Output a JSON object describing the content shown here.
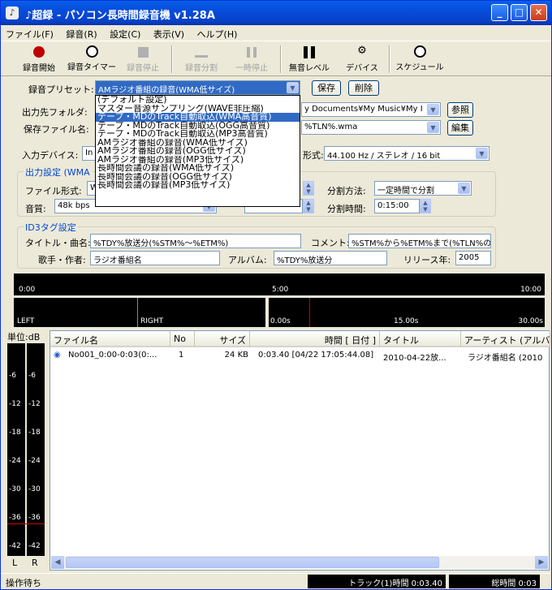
{
  "title": "♪超録 - パソコン長時間録音機 v1.28A",
  "menu": [
    "ファイル(F)",
    "録音(R)",
    "設定(C)",
    "表示(V)",
    "ヘルプ(H)"
  ],
  "toolbar": {
    "record_start": "録音開始",
    "record_timer": "録音タイマー",
    "record_stop": "録音停止",
    "record_split": "録音分割",
    "pause": "一時停止",
    "silence_level": "無音レベル",
    "device": "デバイス",
    "schedule": "スケジュール"
  },
  "preset": {
    "label": "録音プリセット:",
    "value": "AMラジオ番組の録音(WMA低サイズ)",
    "save": "保存",
    "delete": "削除"
  },
  "preset_options": [
    "(デフォルト設定)",
    "マスター音源サンプリング(WAVE非圧縮)",
    "テープ・MDのTrack自動取込(WMA高音質)",
    "テープ・MDのTrack自動取込(OGG高音質)",
    "テープ・MDのTrack自動取込(MP3高音質)",
    "AMラジオ番組の録音(WMA低サイズ)",
    "AMラジオ番組の録音(OGG低サイズ)",
    "AMラジオ番組の録音(MP3低サイズ)",
    "長時間会議の録音(WMA低サイズ)",
    "長時間会議の録音(OGG低サイズ)",
    "長時間会議の録音(MP3低サイズ)"
  ],
  "output": {
    "folder_label": "出力先フォルダ:",
    "folder_value": "y Documents¥My Music¥My I",
    "browse": "参照",
    "file_label": "保存ファイル名:",
    "file_value": "%TLN%.wma",
    "edit": "編集"
  },
  "input": {
    "device_label": "入力デバイス:",
    "device_value": "In",
    "format_label": "形式:",
    "format_value": "44.100 Hz / ステレオ / 16 bit"
  },
  "out_settings": {
    "group_title": "出力設定 (WMA",
    "file_format_label": "ファイル形式:",
    "file_format_value": "W",
    "quality_label": "音質:",
    "quality_value": "48k bps",
    "split_method_label": "分割方法:",
    "split_method_value": "一定時間で分割",
    "split_time_label": "分割時間:",
    "split_time_value": "0:15:00"
  },
  "id3": {
    "group_title": "ID3タグ設定",
    "title_label": "タイトル・曲名:",
    "title_value": "%TDY%放送分(%STM%～%ETM%)",
    "comment_label": "コメント:",
    "comment_value": "%STM%から%ETM%まで(%TLN%の",
    "artist_label": "歌手・作者:",
    "artist_value": "ラジオ番組名",
    "album_label": "アルバム:",
    "album_value": "%TDY%放送分",
    "year_label": "リリース年:",
    "year_value": "2005"
  },
  "timeline": {
    "start": "0:00",
    "mid": "5:00",
    "end": "10:00"
  },
  "levels": {
    "left": "LEFT",
    "right": "RIGHT",
    "t0": "0.00s",
    "t1": "15.00s",
    "t2": "30.00s"
  },
  "vmeter": {
    "unit": "単位:dB",
    "marks": [
      "-6",
      "-12",
      "-18",
      "-24",
      "-30",
      "-36",
      "-42"
    ],
    "l": "L",
    "r": "R"
  },
  "table": {
    "headers": [
      "ファイル名",
      "No",
      "サイズ",
      "時間 [ 日付 ]",
      "タイトル",
      "アーティスト (アルバム)"
    ],
    "rows": [
      [
        "No001_0:00-0:03(0:...",
        "1",
        "24 KB",
        "0:03.40 [04/22 17:05:44.08]",
        "2010-04-22放...",
        "ラジオ番組名 (2010"
      ]
    ]
  },
  "status": {
    "text": "操作待ち",
    "track": "トラック(1)時間 0:03.40",
    "total": "総時間 0:03"
  }
}
